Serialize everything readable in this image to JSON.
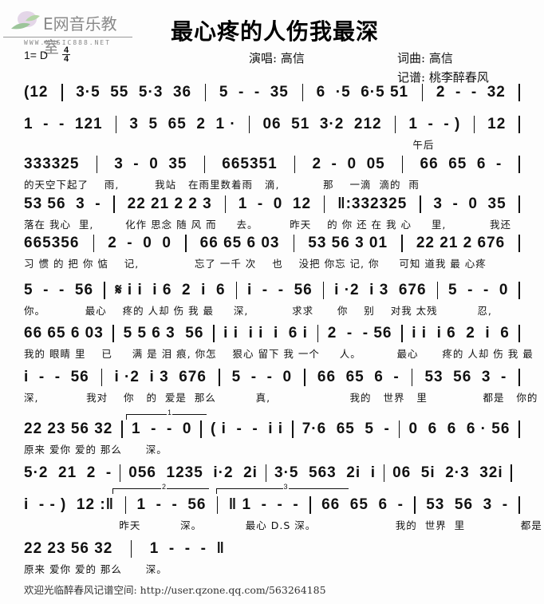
{
  "logo": {
    "name": "E网音乐教室",
    "url": "WWW.MUSIC888.NET"
  },
  "song": {
    "title": "最心疼的人伤我最深",
    "key": "1= D",
    "time_top": "4",
    "time_bottom": "4",
    "singer_label": "演唱:",
    "singer": "高信",
    "composer_label": "词曲:",
    "composer": "高信",
    "transcriber_label": "记谱:",
    "transcriber": "桃李醉春风"
  },
  "rows": [
    {
      "measures": [
        "(12",
        "3·5  55  5·3  36",
        "5  -  -  35",
        "6  ·5  6·5 51",
        "2  -  -  32"
      ],
      "lyrics": ""
    },
    {
      "measures": [
        "1  -  -  121",
        "3  5  65  2  1 ·",
        "06  51  3·2  212",
        "1  -  - )",
        "12"
      ],
      "lyrics": "                                                                                                  午后"
    },
    {
      "measures": [
        "333325",
        "3  -  0  35",
        "665351",
        "2  -  0  05",
        "66  65  6  -"
      ],
      "lyrics": "的天空下起了    雨,         我站   在雨里数着雨   滴,           那    一滴  滴的  雨"
    },
    {
      "measures": [
        "53 56  3  -",
        "22 21 2 2 3",
        "1  -  0  12",
        "‖:332325",
        "3  -  0  35"
      ],
      "lyrics": "落在 我心  里,        化作 思念 随 风 而     去。        昨天    的 你 还 在 我 心     里,           我还"
    },
    {
      "measures": [
        "665356",
        "2  -  0  0",
        "66 65 6 03",
        "53 56 3 01",
        "22 21 2 676"
      ],
      "lyrics": "习 惯 的 把 你 惦    记,              忘了 一千 次    也    没把 你忘 记, 你     可知 道我 最 心疼"
    },
    {
      "measures": [
        "5  -  -  56",
        "𝄋 i i  i 6  2  i  6",
        "i  -  -  56",
        "i ·2  i 3  676",
        "5  -  -  0"
      ],
      "lyrics": "你。          最心    疼的 人却 伤 我 最     深,           求求      你    别    对我 太残          忍,"
    },
    {
      "measures": [
        "66 65 6 03",
        "5 5 6 3  56",
        "i i  i i  i  6 i",
        "2  -  - 56",
        "i i  i 6  2  i  6"
      ],
      "lyrics": "我的 眼睛 里    已     满 是 泪 痕, 你怎    狠心 留下 我 一个     人。         最心      疼的 人却 伤 我 最"
    },
    {
      "measures": [
        "i  -  -  56",
        "i ·2  i 3  676",
        "5  -  -  0",
        "66  65  6  -",
        "53  56  3  -"
      ],
      "lyrics": "深,            我对    你   的  爱是  那么          真,                    我的   世界   里              都是   你的    人,"
    },
    {
      "measures": [
        "22 23 56 32",
        "1  -  -  0",
        "( i  -  -  i i",
        "7·6  65  5  -",
        "0  6  6  6 · 56"
      ],
      "lyrics": "原来 爱你 爱的 那么      深。",
      "volta": "1"
    },
    {
      "measures": [
        "5·2  21  2  -",
        "056  1235  i·2  2i",
        "3·5  563  2i  i",
        "06  5i  2·3  32i"
      ],
      "lyrics": ""
    },
    {
      "measures": [
        "i  - - )  12 :‖",
        "1  -  -  56",
        "‖ 1  -  -  -",
        "66  65  6  -",
        "53  56  3  -"
      ],
      "lyrics": "                        昨天          深。           最心 D.S 深。                    我的  世界  里              都是  你的   人,",
      "voltas": [
        "2",
        "3"
      ]
    },
    {
      "measures": [
        "22 23 56 32",
        "1  -  -  -  ‖"
      ],
      "lyrics": "原来 爱你 爱的 那么      深。"
    }
  ],
  "footer": "欢迎光临醉春风记谱空间: http://user.qzone.qq.com/563264185"
}
